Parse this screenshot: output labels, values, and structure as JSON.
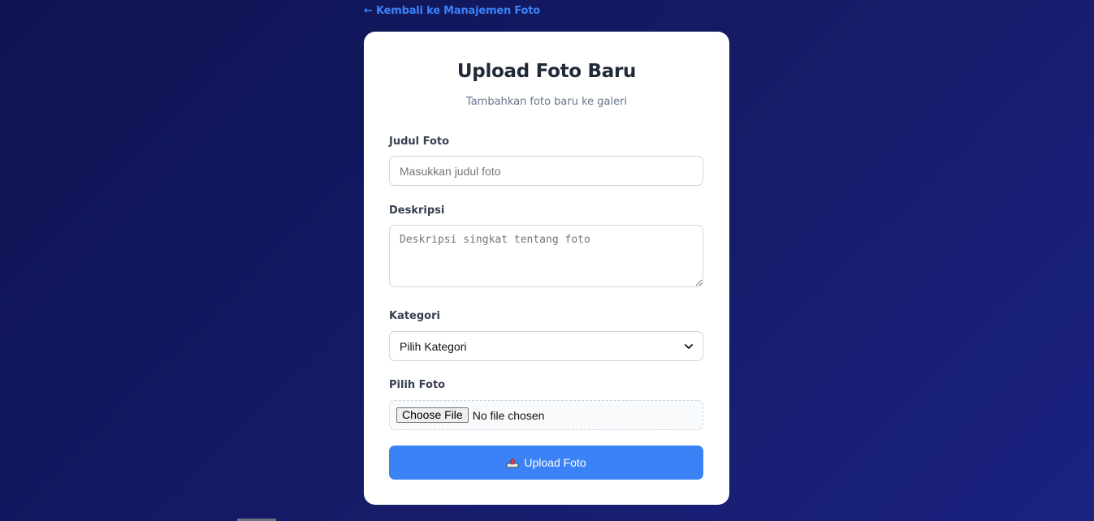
{
  "nav": {
    "back_label": "← Kembali ke Manajemen Foto"
  },
  "card": {
    "title": "Upload Foto Baru",
    "subtitle": "Tambahkan foto baru ke galeri"
  },
  "form": {
    "title_label": "Judul Foto",
    "title_placeholder": "Masukkan judul foto",
    "description_label": "Deskripsi",
    "description_placeholder": "Deskripsi singkat tentang foto",
    "category_label": "Kategori",
    "category_selected": "Pilih Kategori",
    "photo_label": "Pilih Foto",
    "file_button": "Choose File",
    "file_status": "No file chosen",
    "submit_label": "Upload Foto",
    "submit_icon": "upload-tray-icon"
  },
  "colors": {
    "background": "#151b66",
    "accent": "#3b82f6",
    "card": "#ffffff"
  }
}
